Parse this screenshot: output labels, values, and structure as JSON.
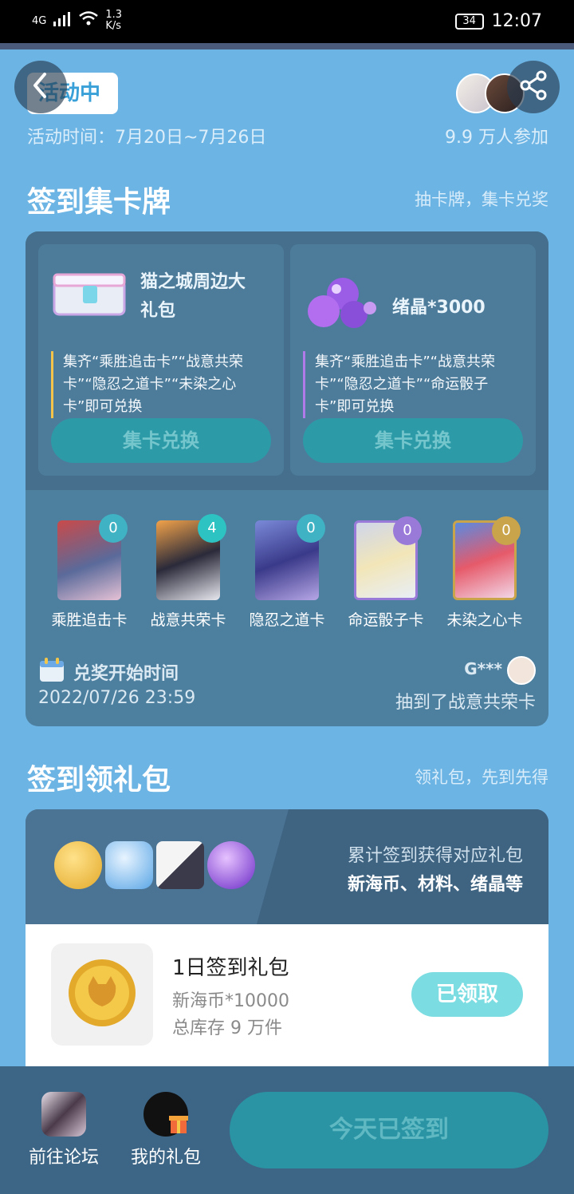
{
  "status_bar": {
    "network": "4G",
    "speed": "1.3\nK/s",
    "battery": "34",
    "time": "12:07"
  },
  "header": {
    "status_label": "活动中",
    "activity_time": "活动时间：7月20日~7月26日",
    "participants": "9.9 万人参加"
  },
  "card_section": {
    "title": "签到集卡牌",
    "subtitle": "抽卡牌，集卡兑奖",
    "rewards": [
      {
        "name": "猫之城周边大\n礼包",
        "desc": "集齐“乘胜追击卡”“战意共荣卡”“隐忍之道卡”“未染之心卡”即可兑换",
        "button": "集卡兑换",
        "accent": "#f3c34a"
      },
      {
        "name": "绪晶*3000",
        "desc": "集齐“乘胜追击卡”“战意共荣卡”“隐忍之道卡”“命运骰子卡”即可兑换",
        "button": "集卡兑换",
        "accent": "#b07ae8"
      }
    ],
    "cards": [
      {
        "label": "乘胜追击卡",
        "count": "0",
        "badge_color": "#3fb3c3"
      },
      {
        "label": "战意共荣卡",
        "count": "4",
        "badge_color": "#2ec3c3"
      },
      {
        "label": "隐忍之道卡",
        "count": "0",
        "badge_color": "#3fb3c3"
      },
      {
        "label": "命运骰子卡",
        "count": "0",
        "badge_color": "#9a7ad8"
      },
      {
        "label": "未染之心卡",
        "count": "0",
        "badge_color": "#c9a44a"
      }
    ],
    "prize_time_label": "兑奖开始时间",
    "prize_time": "2022/07/26 23:59",
    "winner_name": "G***",
    "winner_msg": "抽到了战意共荣卡"
  },
  "gift_section": {
    "title": "签到领礼包",
    "subtitle": "领礼包，先到先得",
    "banner_line1": "累计签到获得对应礼包",
    "banner_line2": "新海币、材料、绪晶等",
    "item": {
      "name": "1日签到礼包",
      "detail": "新海币*10000",
      "stock": "总库存 9 万件",
      "button": "已领取"
    }
  },
  "bottom_bar": {
    "forum": "前往论坛",
    "my_gifts": "我的礼包",
    "checkin": "今天已签到"
  }
}
